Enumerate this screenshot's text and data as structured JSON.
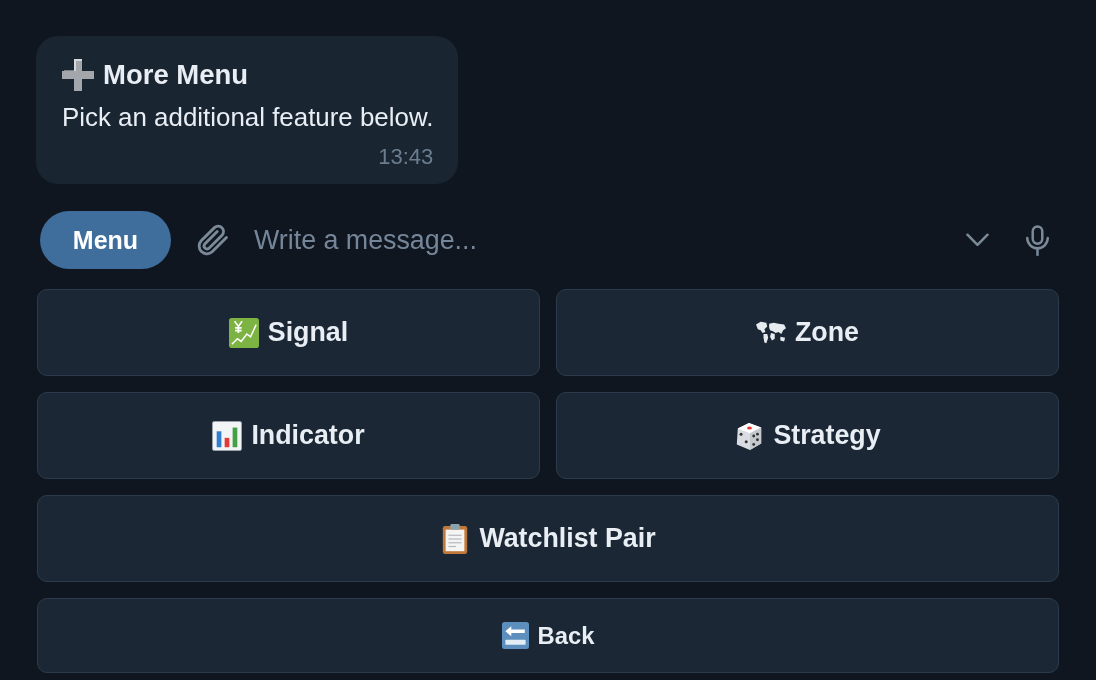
{
  "message": {
    "title": "More Menu",
    "text": "Pick an additional feature below.",
    "time": "13:43"
  },
  "composer": {
    "menu_button": "Menu",
    "placeholder": "Write a message..."
  },
  "keyboard": {
    "rows": [
      {
        "buttons": [
          {
            "label": "Signal",
            "kind": "option"
          },
          {
            "label": "Zone",
            "kind": "option"
          }
        ]
      },
      {
        "buttons": [
          {
            "label": "Indicator",
            "kind": "option"
          },
          {
            "label": "Strategy",
            "kind": "option"
          }
        ]
      },
      {
        "buttons": [
          {
            "label": "Watchlist Pair",
            "kind": "option"
          }
        ]
      },
      {
        "buttons": [
          {
            "label": "Back",
            "kind": "back"
          }
        ]
      }
    ]
  }
}
